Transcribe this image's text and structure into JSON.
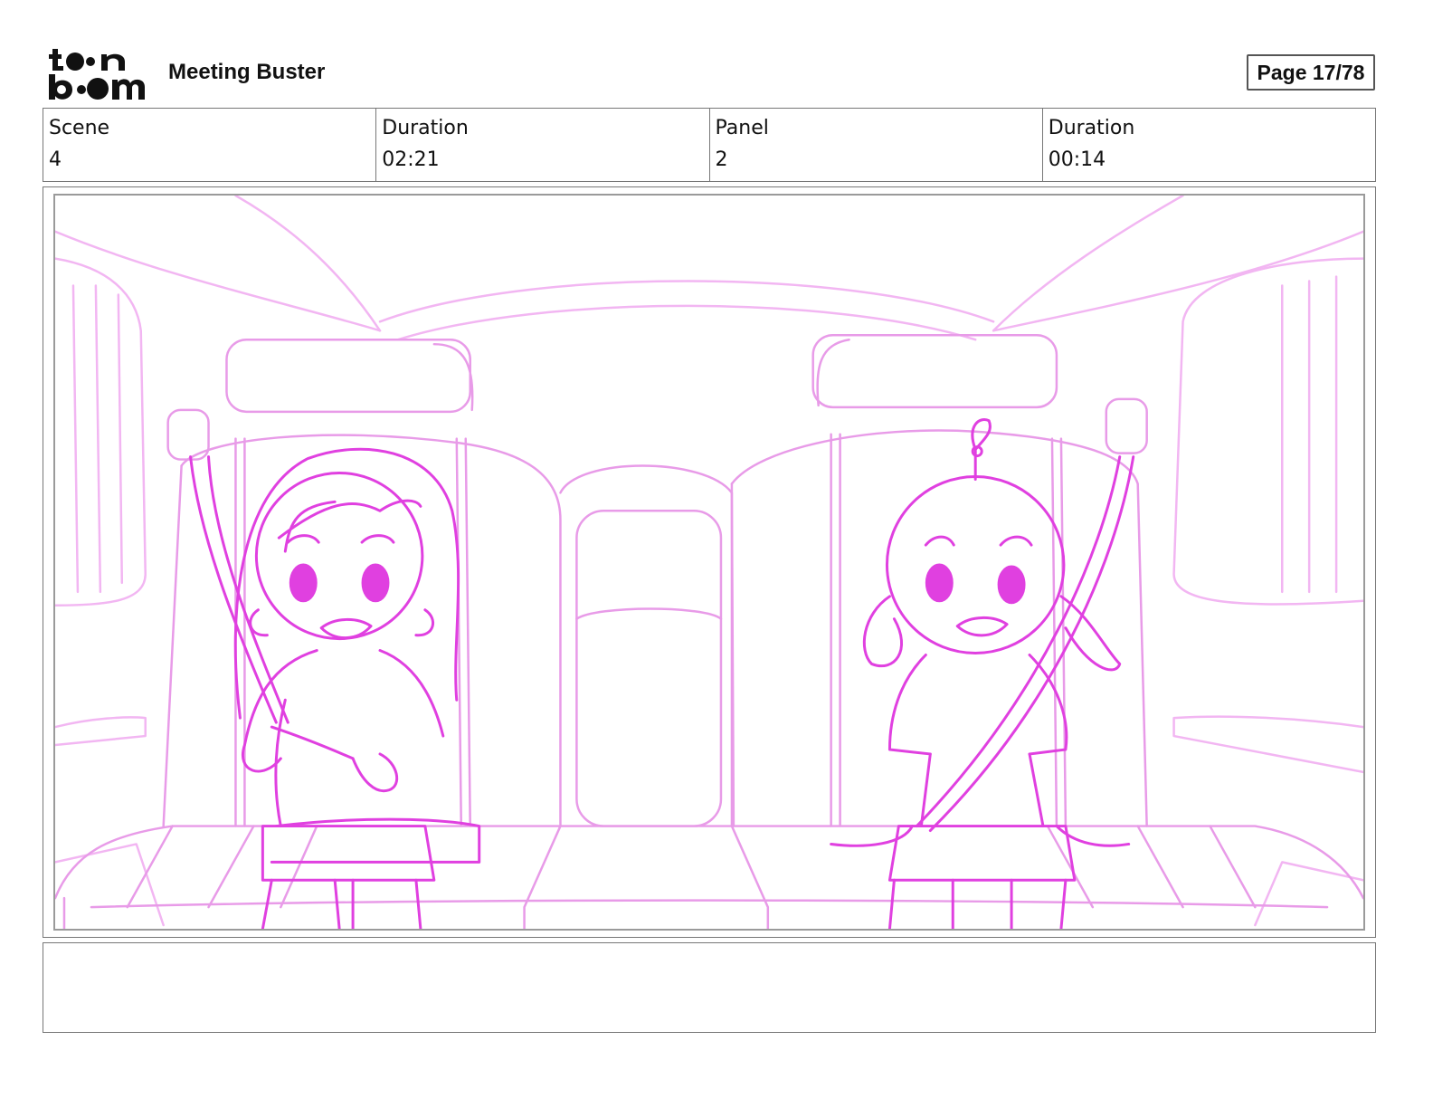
{
  "header": {
    "logo": {
      "text": "toonboom",
      "icon": "toonboom-logo"
    },
    "project_title": "Meeting Buster",
    "page_label": "Page 17/78"
  },
  "info": [
    {
      "label": "Scene",
      "value": "4"
    },
    {
      "label": "Duration",
      "value": "02:21"
    },
    {
      "label": "Panel",
      "value": "2"
    },
    {
      "label": "Duration",
      "value": "00:14"
    }
  ],
  "panel": {
    "description": "",
    "sketch_color": "#e040e0",
    "sketch_light_color": "#f2b6f2"
  },
  "notes": {
    "text": ""
  }
}
